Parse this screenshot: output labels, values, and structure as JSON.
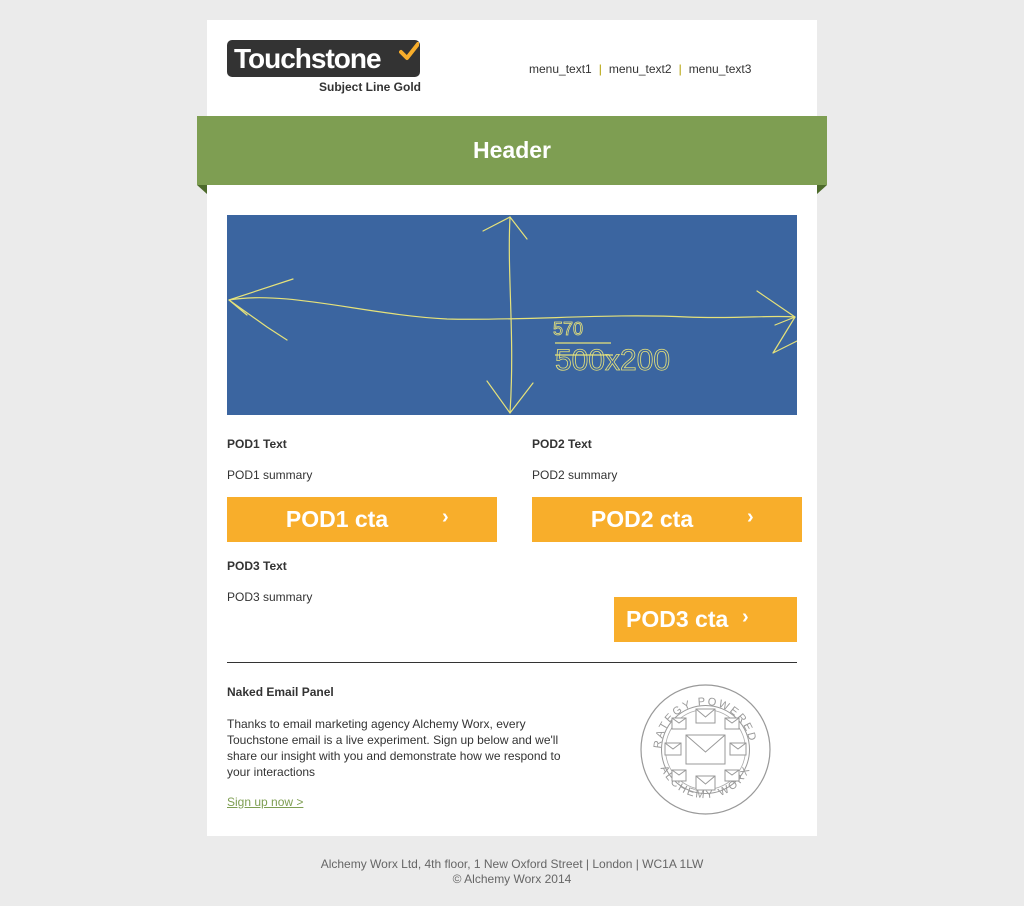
{
  "brand": {
    "logo_word": "Touchstone",
    "tagline": "Subject Line Gold",
    "accent": "#f8ae2b",
    "green": "#7e9e52",
    "hero_blue": "#3b65a0"
  },
  "menu": {
    "item1": "menu_text1",
    "item2": "menu_text2",
    "item3": "menu_text3",
    "separator": "|"
  },
  "header": {
    "title": "Header"
  },
  "hero": {
    "placeholder_text": "570x200",
    "scribble_text": "500x200"
  },
  "pods": [
    {
      "title": "POD1 Text",
      "summary": "POD1 summary",
      "cta": "POD1 cta"
    },
    {
      "title": "POD2 Text",
      "summary": "POD2 summary",
      "cta": "POD2 cta"
    },
    {
      "title": "POD3 Text",
      "summary": "POD3 summary",
      "cta": "POD3 cta"
    }
  ],
  "cta_arrow": "›",
  "panel": {
    "title": "Naked Email Panel",
    "body": "Thanks to email marketing agency Alchemy Worx, every Touchstone email is a live experiment. Sign up below and we'll share our insight with you and demonstrate how we respond to your interactions",
    "link": "Sign up now >",
    "stamp_top": "STRATEGY POWERED BY",
    "stamp_bottom": "ALCHEMY WORX"
  },
  "footer": {
    "address": "Alchemy Worx Ltd, 4th floor, 1 New Oxford Street | London | WC1A 1LW",
    "copyright": "© Alchemy Worx 2014"
  }
}
